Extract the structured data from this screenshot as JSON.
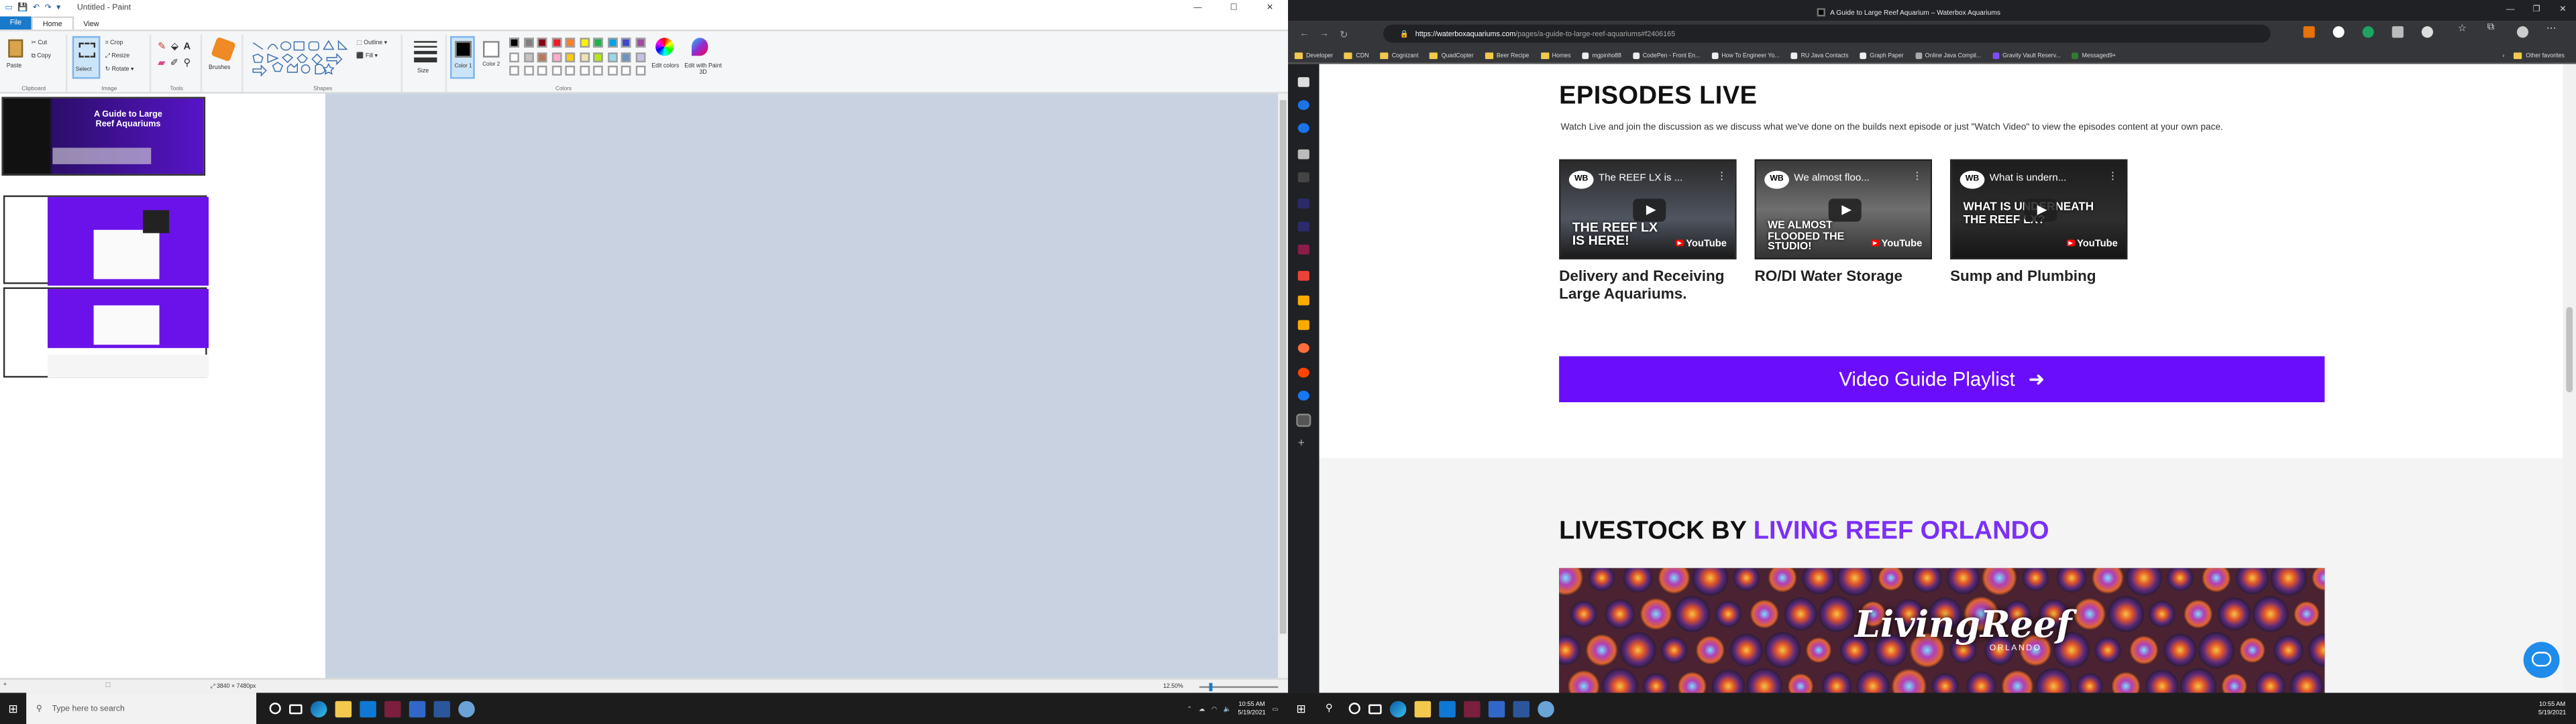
{
  "paint": {
    "title": "Untitled - Paint",
    "menu_file": "File",
    "tabs": [
      "Home",
      "View"
    ],
    "clipboard": {
      "paste": "Paste",
      "cut": "Cut",
      "copy": "Copy",
      "group": "Clipboard"
    },
    "image": {
      "select": "Select",
      "crop": "Crop",
      "resize": "Resize",
      "rotate": "Rotate",
      "group": "Image"
    },
    "tools": {
      "group": "Tools"
    },
    "brushes": "Brushes",
    "shapes": {
      "group": "Shapes",
      "outline": "Outline",
      "fill": "Fill"
    },
    "size": "Size",
    "color1": "Color 1",
    "color2": "Color 2",
    "colors_group": "Colors",
    "edit_colors": "Edit colors",
    "paint3d": "Edit with Paint 3D",
    "palette": [
      "#000000",
      "#7f7f7f",
      "#880015",
      "#ed1c24",
      "#ff7f27",
      "#fff200",
      "#22b14c",
      "#00a2e8",
      "#3f48cc",
      "#a349a4",
      "#ffffff",
      "#c3c3c3",
      "#b97a57",
      "#ffaec9",
      "#ffc90e",
      "#efe4b0",
      "#b5e61d",
      "#99d9ea",
      "#7092be",
      "#c8bfe7"
    ],
    "thumb_heading": "A Guide to Large Reef Aquariums",
    "status_size": "3840 × 7480px",
    "zoom": "12.50%"
  },
  "taskbar": {
    "search_placeholder": "Type here to search",
    "time": "10:55 AM",
    "date": "5/19/2021"
  },
  "browser": {
    "tab_title": "A Guide to Large Reef Aquarium – Waterbox Aquariums",
    "url_host": "https://waterboxaquariums.com",
    "url_path": "/pages/a-guide-to-large-reef-aquariums#f2406165",
    "bookmarks": [
      "Developer",
      "CDN",
      "Cognizant",
      "QuadCopter",
      "Beer Recipe",
      "Homes",
      "mgpinho88",
      "CodePen - Front En...",
      "How To Engineer Yo...",
      "RU Java Contacts",
      "Graph Paper",
      "Online Java Compil...",
      "Gravity Vault Reserv...",
      "Messaged9+"
    ],
    "other_favorites": "Other favorites"
  },
  "page": {
    "episodes_heading": "EPISODES LIVE",
    "episodes_desc": "Watch Live and join the discussion as we discuss what we've done on the builds next episode or just \"Watch Video\" to view the episodes content at your own pace.",
    "videos": [
      {
        "title": "The REEF LX is ...",
        "overlay": "THE REEF LX IS HERE!",
        "caption": "Delivery and Receiving Large Aquariums."
      },
      {
        "title": "We almost floo...",
        "overlay": "WE ALMOST FLOODED THE STUDIO!",
        "caption": "RO/DI Water Storage"
      },
      {
        "title": "What is undern...",
        "overlay": "WHAT IS UNDERNEATH THE REEF LX?",
        "caption": "Sump and Plumbing"
      }
    ],
    "logo_text": "WB",
    "youtube": "YouTube",
    "cta_label": "Video Guide Playlist",
    "livestock_prefix": "LIVESTOCK BY ",
    "livestock_brand": "LIVING REEF ORLANDO",
    "coral_logo": "LivingReef",
    "coral_logo_sub": "ORLANDO"
  }
}
